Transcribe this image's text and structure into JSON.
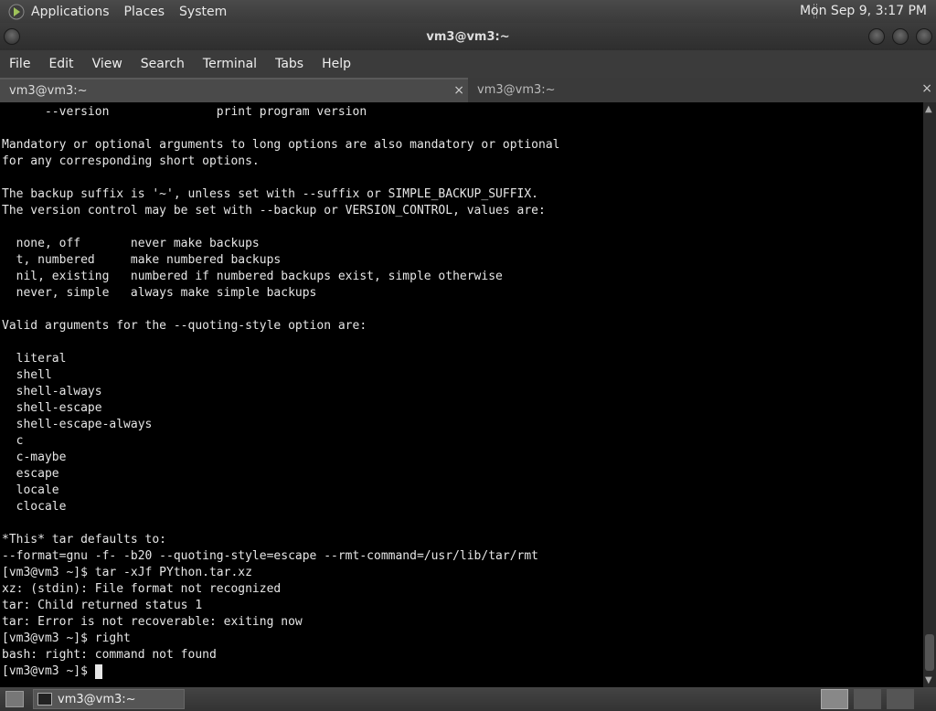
{
  "top_panel": {
    "menus": [
      "Applications",
      "Places",
      "System"
    ],
    "clock": "Mon Sep  9,  3:17 PM"
  },
  "window": {
    "title": "vm3@vm3:~"
  },
  "menubar": [
    "File",
    "Edit",
    "View",
    "Search",
    "Terminal",
    "Tabs",
    "Help"
  ],
  "tabs": [
    {
      "label": "vm3@vm3:~",
      "close": "×"
    },
    {
      "label": "vm3@vm3:~",
      "close": "×"
    }
  ],
  "terminal": {
    "lines": [
      "      --version               print program version",
      "",
      "Mandatory or optional arguments to long options are also mandatory or optional",
      "for any corresponding short options.",
      "",
      "The backup suffix is '~', unless set with --suffix or SIMPLE_BACKUP_SUFFIX.",
      "The version control may be set with --backup or VERSION_CONTROL, values are:",
      "",
      "  none, off       never make backups",
      "  t, numbered     make numbered backups",
      "  nil, existing   numbered if numbered backups exist, simple otherwise",
      "  never, simple   always make simple backups",
      "",
      "Valid arguments for the --quoting-style option are:",
      "",
      "  literal",
      "  shell",
      "  shell-always",
      "  shell-escape",
      "  shell-escape-always",
      "  c",
      "  c-maybe",
      "  escape",
      "  locale",
      "  clocale",
      "",
      "*This* tar defaults to:",
      "--format=gnu -f- -b20 --quoting-style=escape --rmt-command=/usr/lib/tar/rmt",
      "[vm3@vm3 ~]$ tar -xJf PYthon.tar.xz",
      "xz: (stdin): File format not recognized",
      "tar: Child returned status 1",
      "tar: Error is not recoverable: exiting now",
      "[vm3@vm3 ~]$ right",
      "bash: right: command not found"
    ],
    "prompt": "[vm3@vm3 ~]$ "
  },
  "taskbar": {
    "task_label": "vm3@vm3:~"
  },
  "icons": {
    "app_menu": "foot-logo-icon",
    "show_desktop": "show-desktop-icon",
    "terminal_task": "terminal-icon"
  },
  "colors": {
    "terminal_bg": "#000000",
    "terminal_fg": "#e6e6e6",
    "panel": "#3a3a3a"
  }
}
